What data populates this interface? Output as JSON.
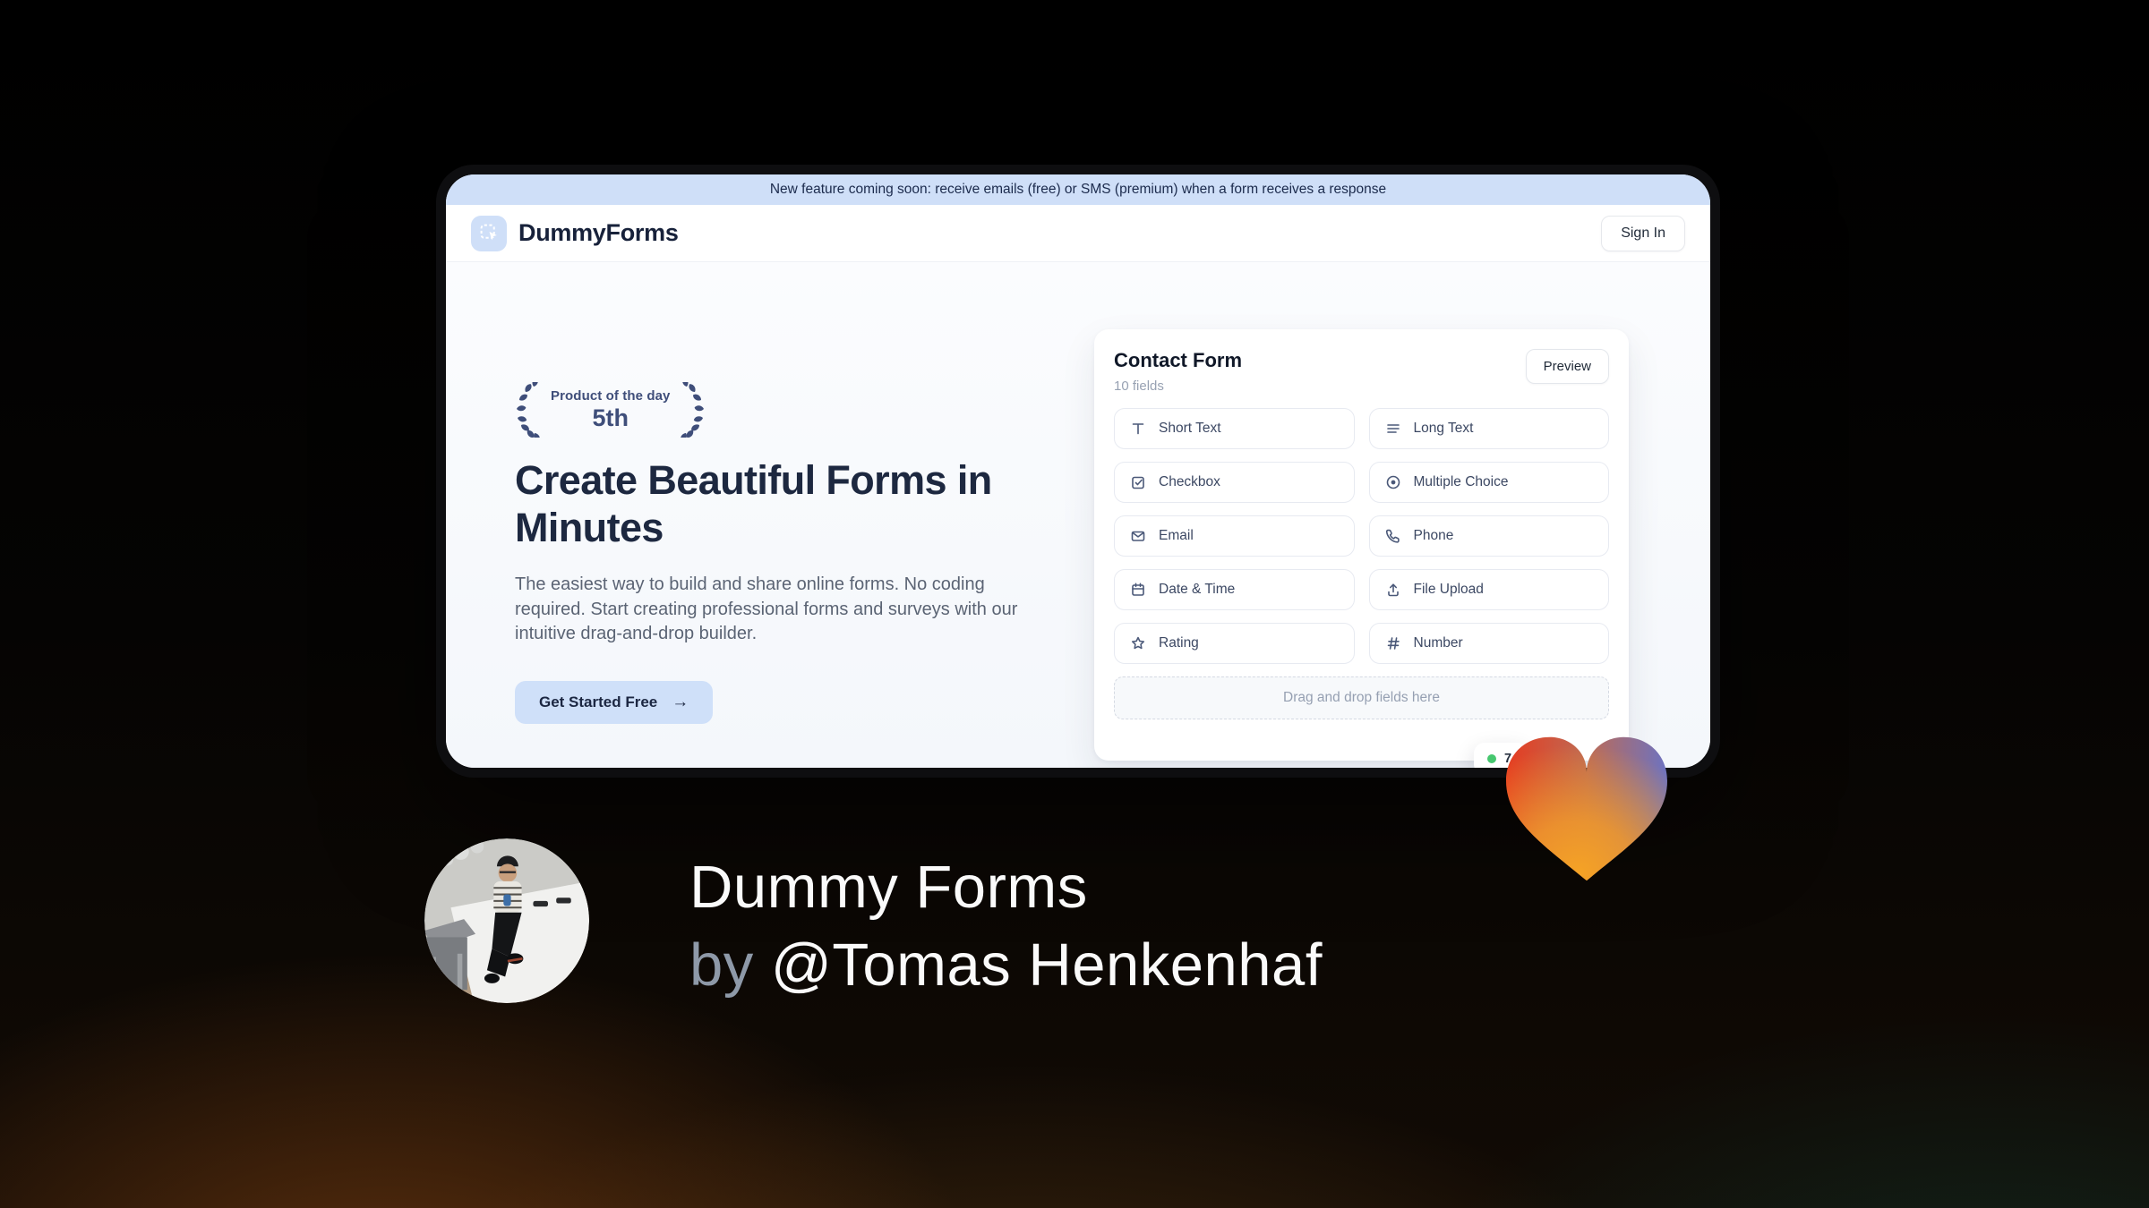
{
  "banner": {
    "text": "New feature coming soon: receive emails (free) or SMS (premium) when a form receives a response"
  },
  "header": {
    "brand": "DummyForms",
    "sign_in_label": "Sign In"
  },
  "hero": {
    "award_line1": "Product of the day",
    "award_line2": "5th",
    "title": "Create Beautiful Forms in\nMinutes",
    "description": "The easiest way to build and share online forms. No coding required. Start creating professional forms and surveys with our intuitive drag-and-drop builder.",
    "cta_label": "Get Started Free",
    "cta_arrow": "→"
  },
  "form_card": {
    "title": "Contact Form",
    "subtitle": "10 fields",
    "preview_label": "Preview",
    "fields": [
      {
        "label": "Short Text",
        "icon": "short-text-icon"
      },
      {
        "label": "Long Text",
        "icon": "long-text-icon"
      },
      {
        "label": "Checkbox",
        "icon": "checkbox-icon"
      },
      {
        "label": "Multiple Choice",
        "icon": "multiple-choice-icon"
      },
      {
        "label": "Email",
        "icon": "email-icon"
      },
      {
        "label": "Phone",
        "icon": "phone-icon"
      },
      {
        "label": "Date & Time",
        "icon": "date-time-icon"
      },
      {
        "label": "File Upload",
        "icon": "file-upload-icon"
      },
      {
        "label": "Rating",
        "icon": "rating-icon"
      },
      {
        "label": "Number",
        "icon": "number-icon"
      }
    ],
    "dropzone_text": "Drag and drop fields here",
    "live_badge_text": "7"
  },
  "footer": {
    "product_name": "Dummy Forms",
    "byline_prefix": "by",
    "author": "@Tomas Henkenhaf"
  },
  "colors": {
    "accent_blue": "#cfe0f9",
    "banner_bg": "#cfdff8",
    "laurel": "#3f4e7a",
    "status_green": "#46c76f",
    "heart_red": "#e63c20",
    "heart_purple": "#6d73c1",
    "heart_orange": "#f5a325"
  }
}
